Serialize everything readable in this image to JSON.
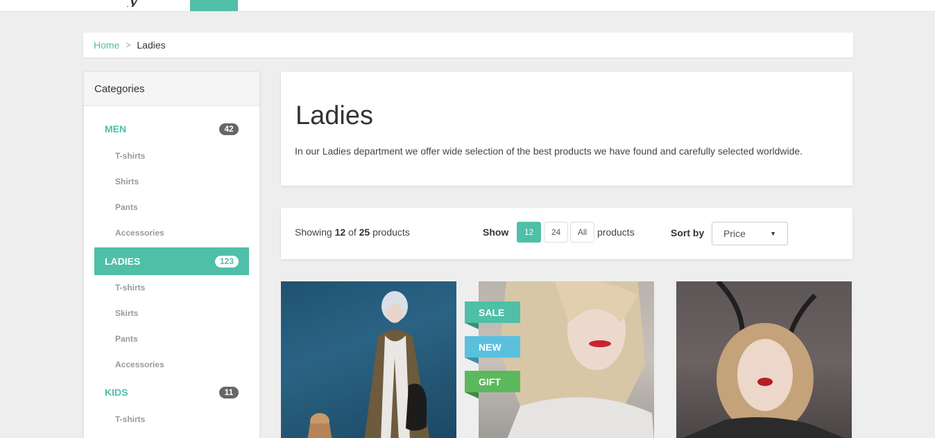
{
  "breadcrumb": {
    "home": "Home",
    "separator": ">",
    "current": "Ladies"
  },
  "sidebar": {
    "title": "Categories",
    "categories": [
      {
        "label": "MEN",
        "count": "42",
        "subitems": [
          "T-shirts",
          "Shirts",
          "Pants",
          "Accessories"
        ]
      },
      {
        "label": "LADIES",
        "count": "123",
        "active": true,
        "subitems": [
          "T-shirts",
          "Skirts",
          "Pants",
          "Accessories"
        ]
      },
      {
        "label": "KIDS",
        "count": "11",
        "subitems": [
          "T-shirts"
        ]
      }
    ]
  },
  "heading": {
    "title": "Ladies",
    "description": "In our Ladies department we offer wide selection of the best products we have found and carefully selected worldwide."
  },
  "toolbar": {
    "showing_prefix": "Showing",
    "showing_count": "12",
    "showing_of": "of",
    "showing_total": "25",
    "showing_suffix": "products",
    "show_label": "Show",
    "page_sizes": [
      "12",
      "24",
      "All"
    ],
    "page_size_active": "12",
    "products_label": "products",
    "sort_label": "Sort by",
    "sort_value": "Price"
  },
  "ribbons": {
    "sale": "SALE",
    "new": "NEW",
    "gift": "GIFT"
  },
  "colors": {
    "accent": "#4fbfa8",
    "ribbon_new": "#5bc0de",
    "ribbon_gift": "#5cb85c",
    "badge_gray": "#666666",
    "page_bg": "#eeeeee"
  }
}
